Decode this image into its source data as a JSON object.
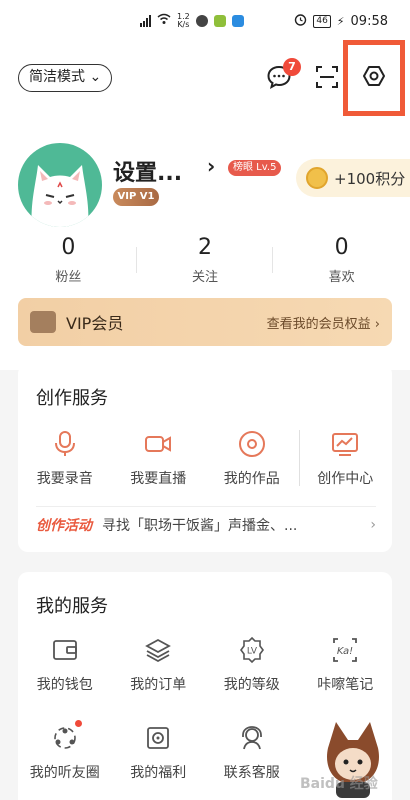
{
  "status_bar": {
    "network_speed_value": "1.2",
    "network_speed_unit": "K/s",
    "battery": "46",
    "time": "09:58"
  },
  "header": {
    "mode_button": "简洁模式 ⌄",
    "message_badge": "7",
    "username": "设置...",
    "vip_tag": "VIP V1",
    "level_tag": "榜眼 Lv.5",
    "points_label": "+100积分",
    "arrow": "›"
  },
  "stats": [
    {
      "value": "0",
      "label": "粉丝"
    },
    {
      "value": "2",
      "label": "关注"
    },
    {
      "value": "0",
      "label": "喜欢"
    }
  ],
  "vip_bar": {
    "title": "VIP会员",
    "link": "查看我的会员权益 ›"
  },
  "creation_services": {
    "title": "创作服务",
    "items": [
      {
        "label": "我要录音",
        "icon": "microphone-icon"
      },
      {
        "label": "我要直播",
        "icon": "video-camera-icon"
      },
      {
        "label": "我的作品",
        "icon": "disc-icon"
      },
      {
        "label": "创作中心",
        "icon": "chart-icon"
      }
    ],
    "activity_tag": "创作活动",
    "activity_text": "寻找「职场干饭酱」声播金、...",
    "activity_chevron": "›"
  },
  "my_services": {
    "title": "我的服务",
    "items": [
      {
        "label": "我的钱包",
        "icon": "wallet-icon"
      },
      {
        "label": "我的订单",
        "icon": "layers-icon"
      },
      {
        "label": "我的等级",
        "icon": "level-badge-icon"
      },
      {
        "label": "咔嚓笔记",
        "icon": "notes-icon"
      },
      {
        "label": "我的听友圈",
        "icon": "friends-circle-icon"
      },
      {
        "label": "我的福利",
        "icon": "gift-box-icon"
      },
      {
        "label": "联系客服",
        "icon": "headset-icon"
      }
    ]
  },
  "watermark": "Baidu 经验",
  "colors": {
    "accent": "#f05a38",
    "vip_bg": "#f2cfa5",
    "avatar_bg": "#4fb996"
  }
}
